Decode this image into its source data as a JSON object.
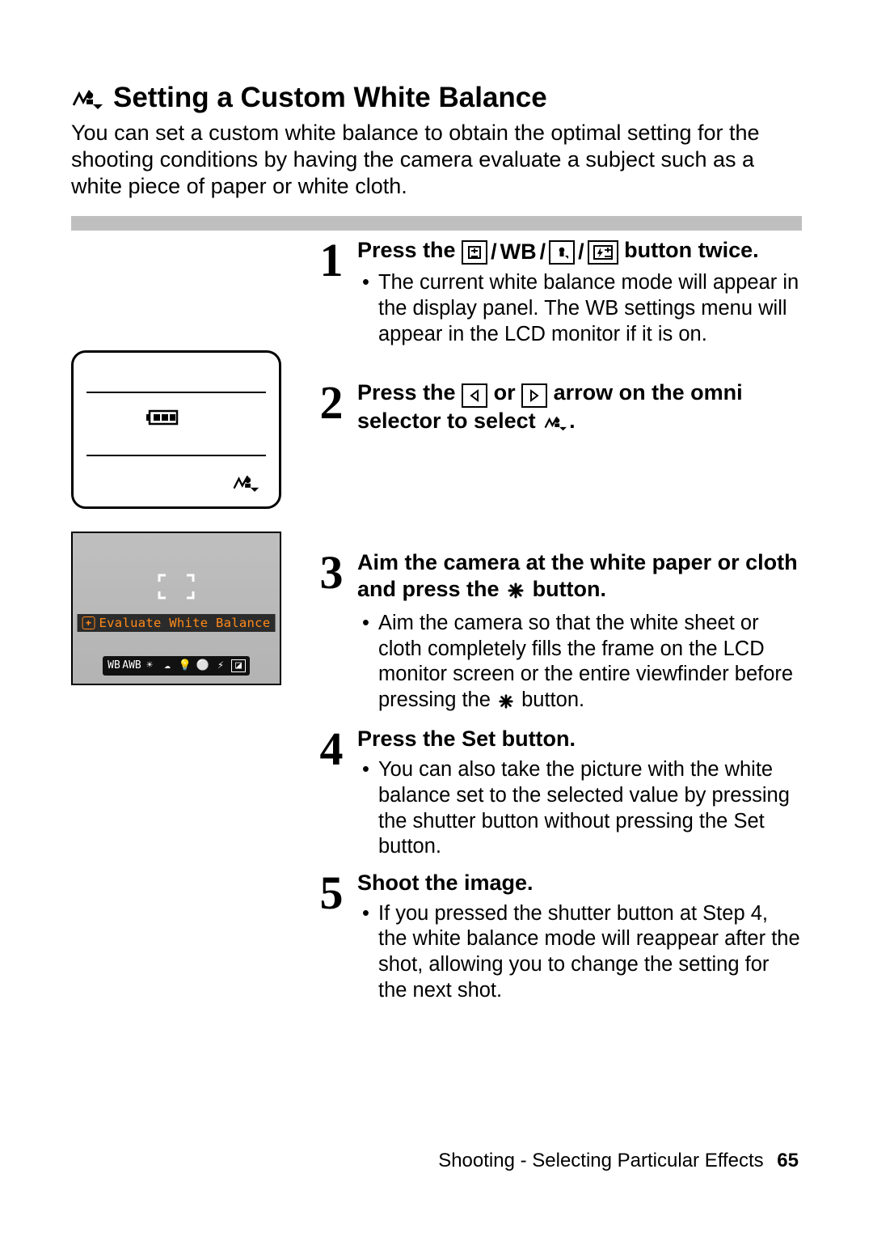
{
  "heading": {
    "title": "Setting a Custom White Balance"
  },
  "intro": "You can set a custom white balance to obtain the optimal setting for the shooting conditions by having the camera evaluate a subject such as a white piece of paper or white cloth.",
  "lcd": {
    "label_text": "Evaluate White Balance",
    "icon_bar": [
      "WB",
      "AWB",
      "☀",
      "☁",
      "💡",
      "⚪",
      "⚡",
      "◪"
    ]
  },
  "steps": [
    {
      "num": "1",
      "lead_pre": "Press the ",
      "lead_post": " button twice.",
      "bullets": [
        "The current white balance mode will appear in the display panel. The WB settings menu will appear in the LCD monitor if it is on."
      ]
    },
    {
      "num": "2",
      "lead_pre": "Press the ",
      "lead_mid": " or ",
      "lead_mid2": " arrow on the omni selector to select ",
      "lead_post": ".",
      "bullets": []
    },
    {
      "num": "3",
      "lead_pre": "Aim the camera at the white paper or cloth and press the ",
      "lead_post": " button.",
      "bullets": [
        "Aim the camera so that the white sheet or cloth completely fills the frame on the LCD monitor screen or the entire viewfinder before pressing the "
      ],
      "bullet_tail": " button."
    },
    {
      "num": "4",
      "lead_pre": "Press the Set button.",
      "bullets": [
        "You can also take the picture with the white balance set to the selected value by pressing the shutter button without pressing the Set button."
      ]
    },
    {
      "num": "5",
      "lead_pre": "Shoot the image.",
      "bullets": [
        "If you pressed the shutter button at Step 4, the white balance mode will reappear after the shot, allowing you to change the setting for the next shot."
      ]
    }
  ],
  "footer": {
    "section": "Shooting - Selecting Particular Effects",
    "page": "65"
  },
  "icons": {
    "wb_button_label": "WB",
    "exposure_pm": "±",
    "arrow_left": "◁",
    "arrow_right": "▷",
    "eval_glyph": "✱"
  }
}
